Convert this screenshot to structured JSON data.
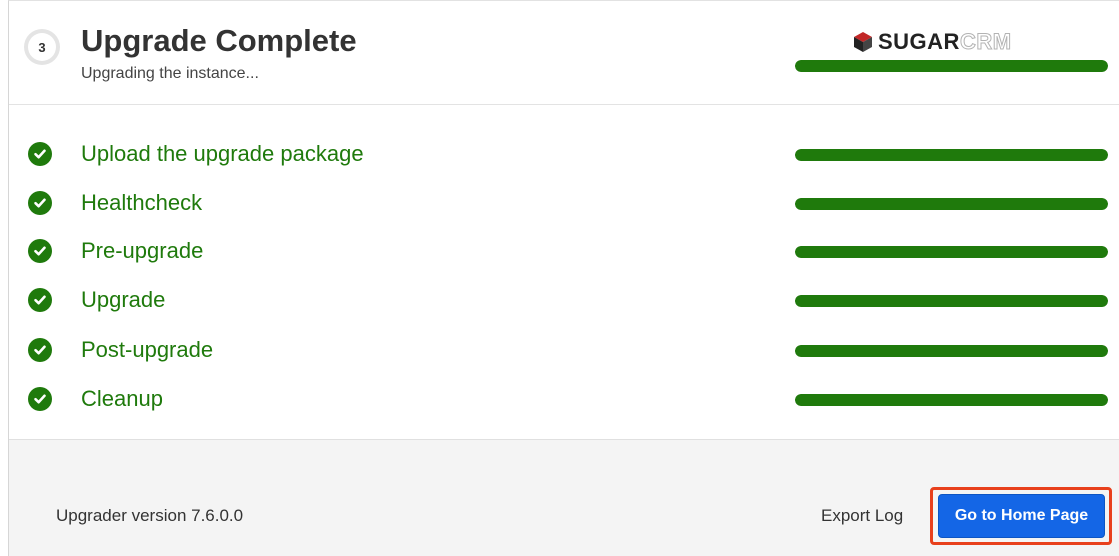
{
  "header": {
    "step_number": "3",
    "title": "Upgrade Complete",
    "subtitle": "Upgrading the instance...",
    "overall_progress": 1.0
  },
  "logo": {
    "part1": "SUGAR",
    "part2": "CRM",
    "icon": "sugar-cube-icon"
  },
  "steps": [
    {
      "label": "Upload the upgrade package",
      "progress": 1.0,
      "status": "complete"
    },
    {
      "label": "Healthcheck",
      "progress": 1.0,
      "status": "complete"
    },
    {
      "label": "Pre-upgrade",
      "progress": 1.0,
      "status": "complete"
    },
    {
      "label": "Upgrade",
      "progress": 1.0,
      "status": "complete"
    },
    {
      "label": "Post-upgrade",
      "progress": 1.0,
      "status": "complete"
    },
    {
      "label": "Cleanup",
      "progress": 1.0,
      "status": "complete"
    }
  ],
  "footer": {
    "version": "Upgrader version 7.6.0.0",
    "export_log": "Export Log",
    "home_button": "Go to Home Page"
  },
  "colors": {
    "success": "#1f7a0c",
    "primary_button": "#1466e6",
    "highlight": "#e8401c"
  }
}
